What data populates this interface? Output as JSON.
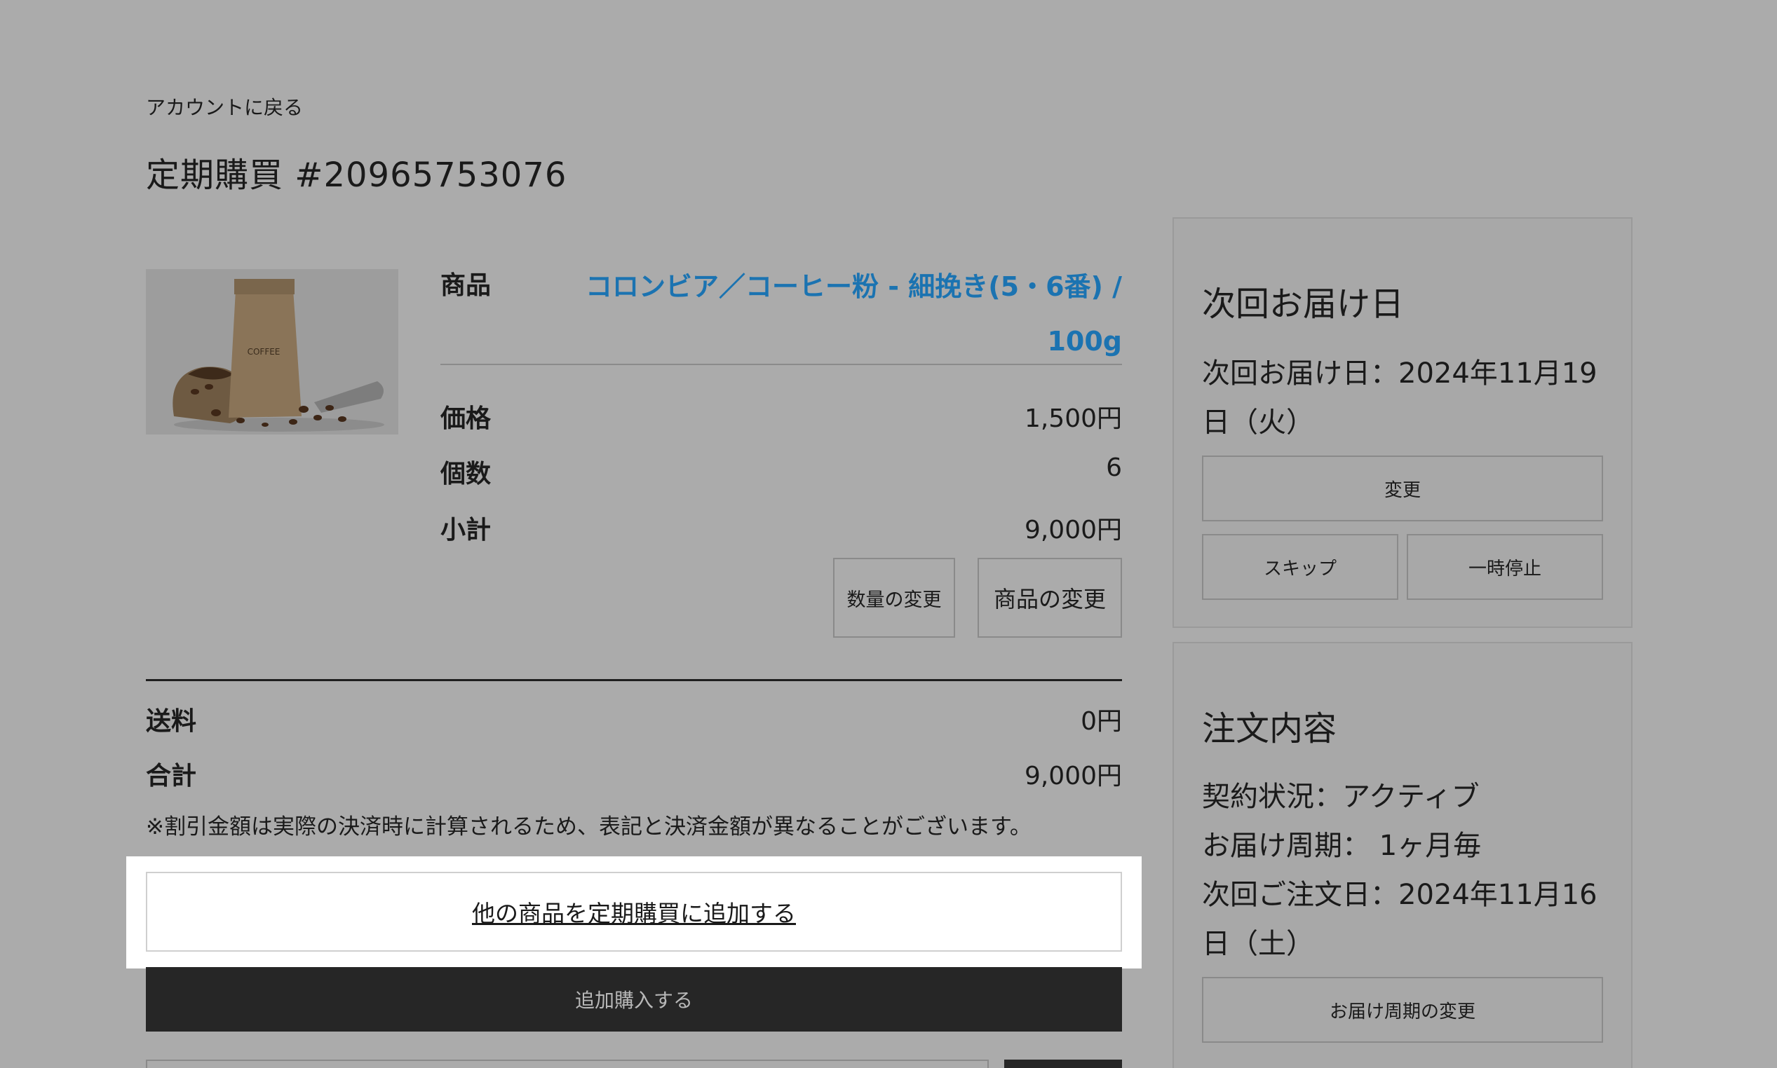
{
  "header": {
    "back_link": "アカウントに戻る",
    "title": "定期購買 #20965753076"
  },
  "product": {
    "image_alt": "coffee-bag-image",
    "name_label": "商品",
    "name": "コロンビア／コーヒー粉 - 細挽き(5・6番) / 100g",
    "price_label": "価格",
    "price": "1,500円",
    "quantity_label": "個数",
    "quantity": "6",
    "subtotal_label": "小計",
    "subtotal": "9,000円",
    "change_quantity_button": "数量の変更",
    "change_product_button": "商品の変更"
  },
  "totals": {
    "shipping_label": "送料",
    "shipping": "0円",
    "total_label": "合計",
    "total": "9,000円",
    "note": "※割引金額は実際の決済時に計算されるため、表記と決済金額が異なることがございます。"
  },
  "actions": {
    "add_other_product": "他の商品を定期購買に追加する",
    "add_purchase": "追加購入する"
  },
  "next_delivery": {
    "title": "次回お届け日",
    "text": "次回お届け日：2024年11月19日（火）",
    "change_button": "変更",
    "skip_button": "スキップ",
    "pause_button": "一時停止"
  },
  "order_details": {
    "title": "注文内容",
    "status": "契約状況：アクティブ",
    "cycle": "お届け周期： 1ヶ月毎",
    "next_order": "次回ご注文日：2024年11月16日（土）",
    "change_cycle_button": "お届け周期の変更"
  }
}
